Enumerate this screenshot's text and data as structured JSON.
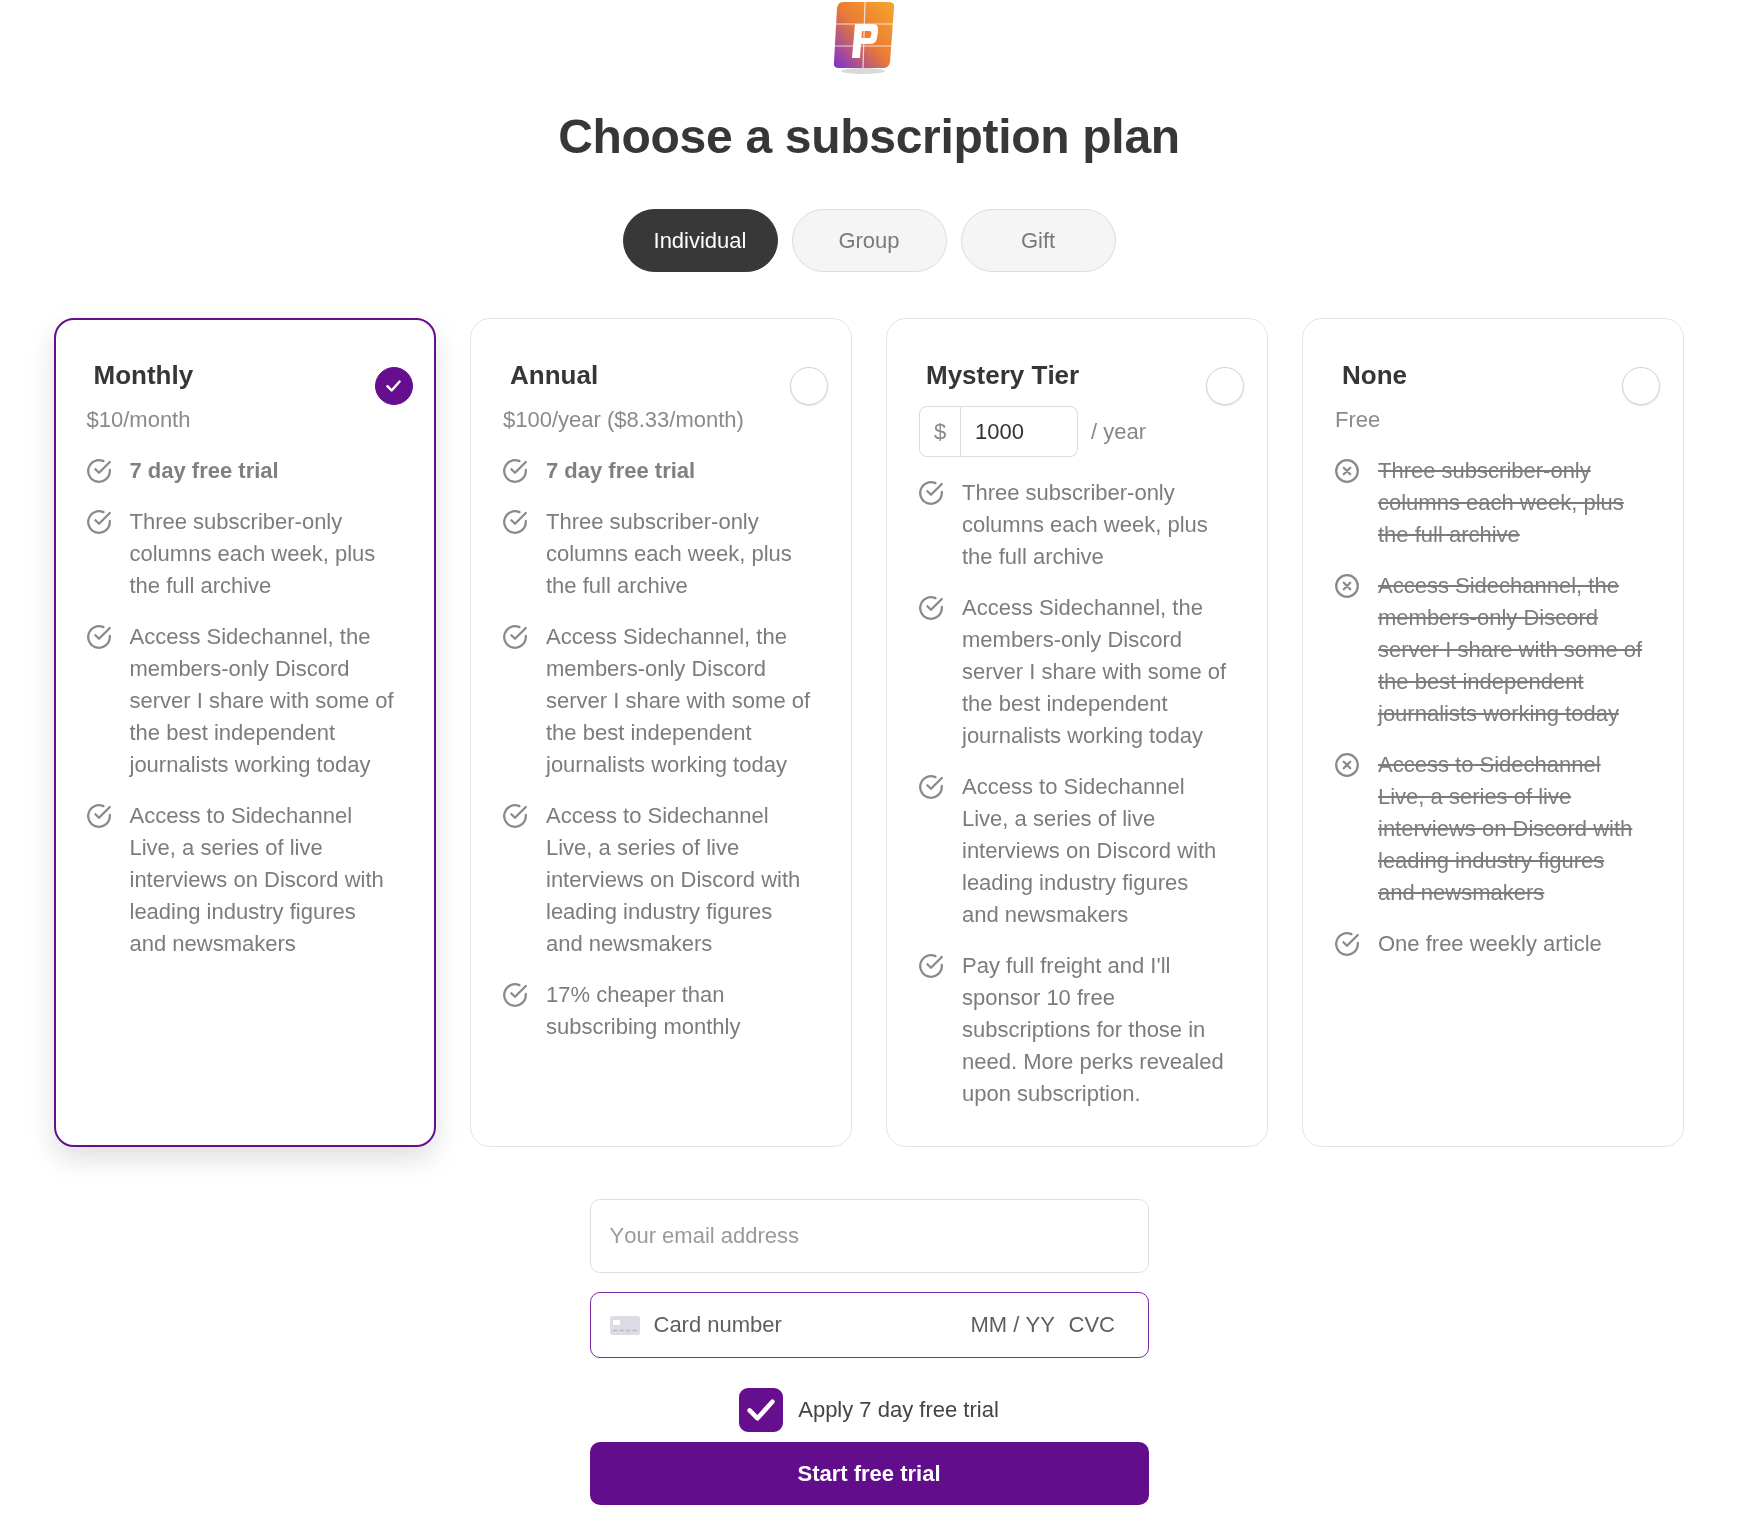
{
  "page": {
    "title": "Choose a subscription plan"
  },
  "tabs": [
    {
      "label": "Individual",
      "selected": true
    },
    {
      "label": "Group",
      "selected": false
    },
    {
      "label": "Gift",
      "selected": false
    }
  ],
  "plans": [
    {
      "kind": "fixed",
      "name": "Monthly",
      "price": "$10/month",
      "selected": true,
      "features": [
        {
          "text": "7 day free trial",
          "included": true,
          "emphasis": true
        },
        {
          "text": "Three subscriber-only columns each week, plus the full archive",
          "included": true,
          "emphasis": false
        },
        {
          "text": "Access Sidechannel, the members-only Discord server I share with some of the best independent journalists working today",
          "included": true,
          "emphasis": false
        },
        {
          "text": "Access to Sidechannel Live, a series of live interviews on Discord with leading industry figures and newsmakers",
          "included": true,
          "emphasis": false
        }
      ]
    },
    {
      "kind": "fixed",
      "name": "Annual",
      "price": "$100/year ($8.33/month)",
      "selected": false,
      "features": [
        {
          "text": "7 day free trial",
          "included": true,
          "emphasis": true
        },
        {
          "text": "Three subscriber-only columns each week, plus the full archive",
          "included": true,
          "emphasis": false
        },
        {
          "text": "Access Sidechannel, the members-only Discord server I share with some of the best independent journalists working today",
          "included": true,
          "emphasis": false
        },
        {
          "text": "Access to Sidechannel Live, a series of live interviews on Discord with leading industry figures and newsmakers",
          "included": true,
          "emphasis": false
        },
        {
          "text": "17% cheaper than subscribing monthly",
          "included": true,
          "emphasis": false
        }
      ]
    },
    {
      "kind": "custom",
      "name": "Mystery Tier",
      "price_input": {
        "currency": "$",
        "value": "1000",
        "period": "/ year"
      },
      "selected": false,
      "features": [
        {
          "text": "Three subscriber-only columns each week, plus the full archive",
          "included": true,
          "emphasis": false
        },
        {
          "text": "Access Sidechannel, the members-only Discord server I share with some of the best independent journalists working today",
          "included": true,
          "emphasis": false
        },
        {
          "text": "Access to Sidechannel Live, a series of live interviews on Discord with leading industry figures and newsmakers",
          "included": true,
          "emphasis": false
        },
        {
          "text": "Pay full freight and I'll sponsor 10 free subscriptions for those in need. More perks revealed upon subscription.",
          "included": true,
          "emphasis": false
        }
      ]
    },
    {
      "kind": "fixed",
      "name": "None",
      "price": "Free",
      "selected": false,
      "features": [
        {
          "text": "Three subscriber-only columns each week, plus the full archive",
          "included": false,
          "emphasis": false
        },
        {
          "text": "Access Sidechannel, the members-only Discord server I share with some of the best independent journalists working today",
          "included": false,
          "emphasis": false
        },
        {
          "text": "Access to Sidechannel Live, a series of live interviews on Discord with leading industry figures and newsmakers",
          "included": false,
          "emphasis": false
        },
        {
          "text": "One free weekly article",
          "included": true,
          "emphasis": false
        }
      ]
    }
  ],
  "form": {
    "email": {
      "placeholder": "Your email address"
    },
    "card": {
      "number_placeholder": "Card number",
      "expiry_placeholder": "MM / YY",
      "cvc_placeholder": "CVC"
    },
    "trial": {
      "label": "Apply 7 day free trial",
      "checked": true
    },
    "submit": "Start free trial"
  }
}
